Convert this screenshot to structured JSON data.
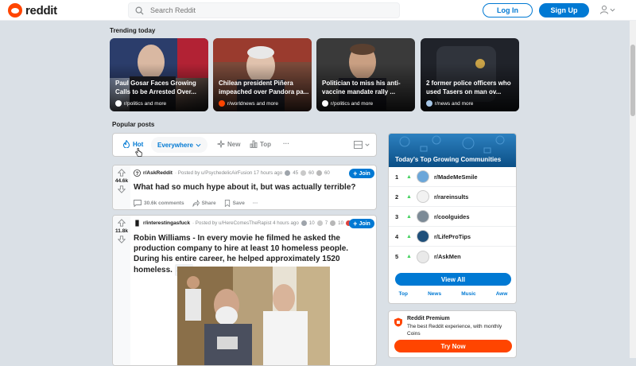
{
  "header": {
    "logo_text": "reddit",
    "search_placeholder": "Search Reddit",
    "login_label": "Log In",
    "signup_label": "Sign Up"
  },
  "trending": {
    "heading": "Trending today",
    "cards": [
      {
        "title": "Paul Gosar Faces Growing Calls to be Arrested Over...",
        "subreddit": "r/politics and more"
      },
      {
        "title": "Chilean president Piñera impeached over Pandora pa...",
        "subreddit": "r/worldnews and more"
      },
      {
        "title": "Politician to miss his anti-vaccine mandate rally ...",
        "subreddit": "r/politics and more"
      },
      {
        "title": "2 former police officers who used Tasers on man ov...",
        "subreddit": "r/news and more"
      }
    ]
  },
  "popular": {
    "heading": "Popular posts",
    "filters": {
      "hot": "Hot",
      "location": "Everywhere",
      "new": "New",
      "top": "Top",
      "more": "···"
    }
  },
  "posts": [
    {
      "votes": "44.6k",
      "subreddit": "r/AskReddit",
      "posted_by": "· Posted by u/PsychedelicAirFusion 17 hours ago",
      "awards": [
        "45",
        "60",
        "60"
      ],
      "title": "What had so much hype about it, but was actually terrible?",
      "comments": "30.6k comments",
      "share": "Share",
      "save": "Save",
      "more": "···",
      "join": "Join"
    },
    {
      "votes": "11.8k",
      "subreddit": "r/interestingasfuck",
      "posted_by": "· Posted by u/HereComesTheRapist 4 hours ago",
      "awards": [
        "10",
        "7",
        "10"
      ],
      "title": "Robin Williams - In every movie he filmed he asked the production company to hire at least 10 homeless people. During his entire career, he helped approximately 1520 homeless.",
      "flair": "/r/ALL",
      "join": "Join"
    }
  ],
  "sidebar": {
    "title": "Today's Top Growing Communities",
    "communities": [
      {
        "rank": "1",
        "name": "r/MadeMeSmile"
      },
      {
        "rank": "2",
        "name": "r/rareinsults"
      },
      {
        "rank": "3",
        "name": "r/coolguides"
      },
      {
        "rank": "4",
        "name": "r/LifeProTips"
      },
      {
        "rank": "5",
        "name": "r/AskMen"
      }
    ],
    "view_all": "View All",
    "tabs": [
      "Top",
      "News",
      "Music",
      "Aww"
    ]
  },
  "premium": {
    "title": "Reddit Premium",
    "description": "The best Reddit experience, with monthly Coins",
    "button": "Try Now"
  },
  "colors": {
    "accent": "#0079d3",
    "brand": "#ff4500",
    "upvote_green": "#46d160"
  }
}
